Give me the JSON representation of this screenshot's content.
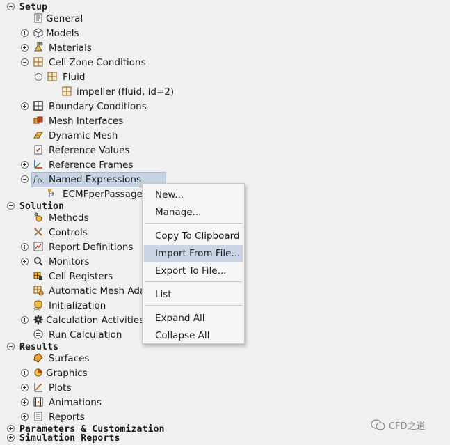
{
  "tree": {
    "setup": "Setup",
    "general": "General",
    "models": "Models",
    "materials": "Materials",
    "cell_zone": "Cell Zone Conditions",
    "fluid": "Fluid",
    "impeller": "impeller (fluid, id=2)",
    "boundary": "Boundary Conditions",
    "mesh_interfaces": "Mesh Interfaces",
    "dynamic_mesh": "Dynamic Mesh",
    "reference_values": "Reference Values",
    "reference_frames": "Reference Frames",
    "named_expressions": "Named Expressions",
    "ecmf": "ECMFperPassage",
    "solution": "Solution",
    "methods": "Methods",
    "controls": "Controls",
    "report_definitions": "Report Definitions",
    "monitors": "Monitors",
    "cell_registers": "Cell Registers",
    "auto_mesh": "Automatic Mesh Adap",
    "initialization": "Initialization",
    "calc_activities": "Calculation Activities",
    "run_calc": "Run Calculation",
    "results": "Results",
    "surfaces": "Surfaces",
    "graphics": "Graphics",
    "plots": "Plots",
    "animations": "Animations",
    "reports": "Reports",
    "parameters": "Parameters & Customization",
    "sim_reports": "Simulation Reports"
  },
  "context_menu": {
    "new": "New...",
    "manage": "Manage...",
    "copy": "Copy To Clipboard",
    "import": "Import From File...",
    "export": "Export To File...",
    "list": "List",
    "expand": "Expand All",
    "collapse": "Collapse All"
  },
  "watermark": "CFD之道",
  "colors": {
    "selection": "#c6d3e2",
    "menu_hover": "#c9d5e3",
    "background": "#f0f0f0"
  }
}
